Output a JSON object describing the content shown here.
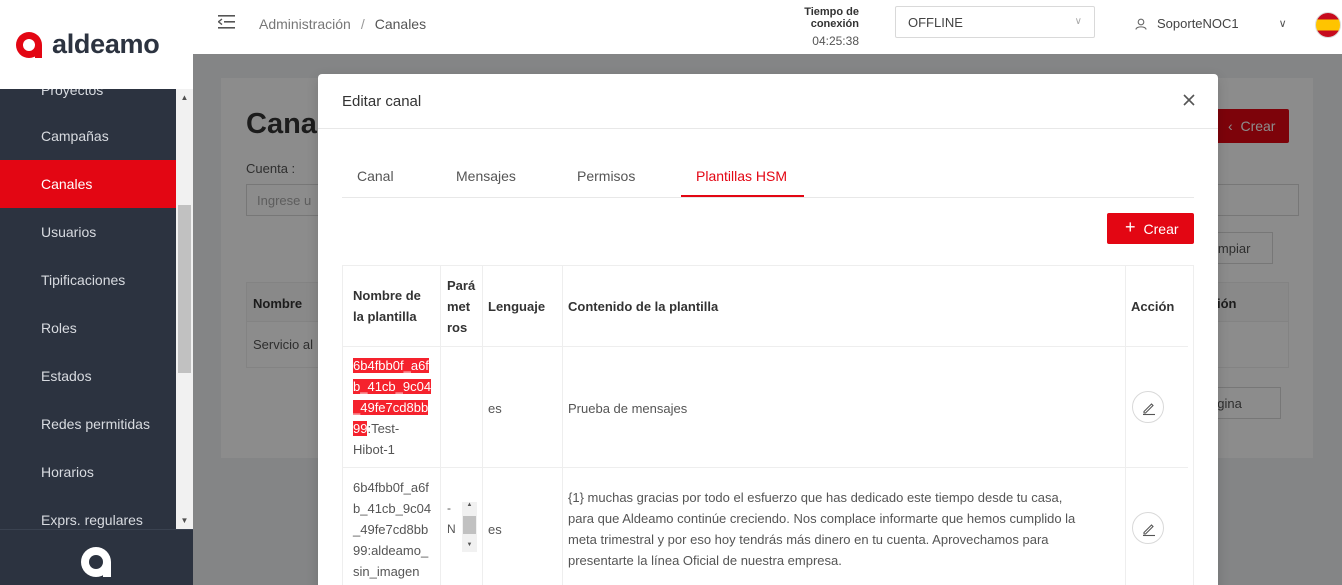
{
  "brand": {
    "name": "aldeamo",
    "accent": "#e30613"
  },
  "sidebar": {
    "items": [
      {
        "label": "Proyectos"
      },
      {
        "label": "Campañas"
      },
      {
        "label": "Canales",
        "active": true
      },
      {
        "label": "Usuarios"
      },
      {
        "label": "Tipificaciones"
      },
      {
        "label": "Roles"
      },
      {
        "label": "Estados"
      },
      {
        "label": "Redes permitidas"
      },
      {
        "label": "Horarios"
      },
      {
        "label": "Exprs. regulares"
      }
    ]
  },
  "header": {
    "breadcrumb": [
      "Administración",
      "Canales"
    ],
    "breadcrumb_sep": "/",
    "connection_label": "Tiempo de conexión",
    "connection_time": "04:25:38",
    "status": "OFFLINE",
    "user": "SoporteNOC1"
  },
  "background_page": {
    "title": "Canal",
    "create_label": "Crear",
    "account_label": "Cuenta :",
    "account_placeholder": "Ingrese u",
    "clear_label": "impiar",
    "col_name": "Nombre",
    "col_action": "ión",
    "row_text": "Servicio al",
    "pagination_label": "ágina"
  },
  "modal": {
    "title": "Editar canal",
    "tabs": [
      {
        "label": "Canal"
      },
      {
        "label": "Mensajes"
      },
      {
        "label": "Permisos"
      },
      {
        "label": "Plantillas HSM",
        "active": true
      }
    ],
    "create_label": "Crear",
    "table": {
      "headers": {
        "name": [
          "Nombre de",
          "la plantilla"
        ],
        "params": [
          "Pará",
          "met",
          "ros"
        ],
        "language": "Lenguaje",
        "content": "Contenido de la plantilla",
        "action": "Acción"
      },
      "rows": [
        {
          "name_highlighted": [
            "6b4fbb0f_a6f",
            "b_41cb_9c04",
            "_49fe7cd8bb",
            "99"
          ],
          "name_rest_first": ":Test-",
          "name_rest": "Hibot-1",
          "params": "",
          "language": "es",
          "content": "Prueba de mensajes"
        },
        {
          "name": [
            "6b4fbb0f_a6f",
            "b_41cb_9c04",
            "_49fe7cd8bb",
            "99:aldeamo_",
            "sin_imagen"
          ],
          "params": [
            "-",
            "N"
          ],
          "language": "es",
          "content": [
            "{1} muchas gracias por todo el esfuerzo que has dedicado este tiempo desde tu casa,",
            "para que Aldeamo continúe creciendo. Nos complace informarte que hemos cumplido la",
            "meta trimestral y por eso hoy tendrás más dinero en tu cuenta. Aprovechamos para",
            "presentarte la línea Oficial de nuestra empresa."
          ]
        }
      ]
    }
  }
}
